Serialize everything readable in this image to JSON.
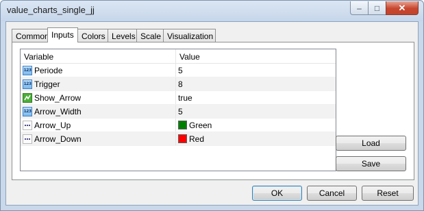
{
  "window": {
    "title": "value_charts_single_jj"
  },
  "tabs": [
    {
      "label": "Common"
    },
    {
      "label": "Inputs"
    },
    {
      "label": "Colors"
    },
    {
      "label": "Levels"
    },
    {
      "label": "Scale"
    },
    {
      "label": "Visualization"
    }
  ],
  "active_tab": "Inputs",
  "table": {
    "headers": [
      "Variable",
      "Value"
    ],
    "rows": [
      {
        "type_icon": "number-icon",
        "variable": "Periode",
        "value": "5"
      },
      {
        "type_icon": "number-icon",
        "variable": "Trigger",
        "value": "8"
      },
      {
        "type_icon": "boolean-icon",
        "variable": "Show_Arrow",
        "value": "true"
      },
      {
        "type_icon": "number-icon",
        "variable": "Arrow_Width",
        "value": "5"
      },
      {
        "type_icon": "enum-icon",
        "variable": "Arrow_Up",
        "value": "Green",
        "swatch": "#008000"
      },
      {
        "type_icon": "enum-icon",
        "variable": "Arrow_Down",
        "value": "Red",
        "swatch": "#ff0000"
      }
    ]
  },
  "side_buttons": {
    "load": "Load",
    "save": "Save"
  },
  "footer_buttons": {
    "ok": "OK",
    "cancel": "Cancel",
    "reset": "Reset"
  },
  "colors": {
    "close_button": "#c7462e",
    "number_icon": "#7ab8ec"
  }
}
